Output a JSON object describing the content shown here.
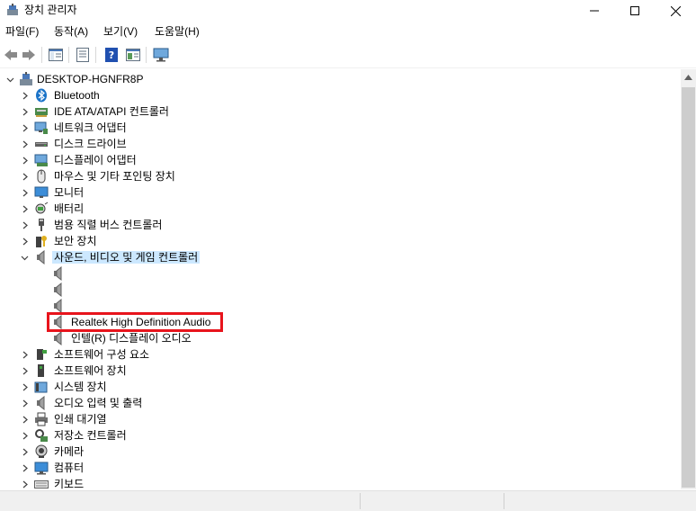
{
  "window": {
    "title": "장치 관리자"
  },
  "menu": [
    "파일(F)",
    "동작(A)",
    "보기(V)",
    "도움말(H)"
  ],
  "icons": {
    "title": "device-manager-icon",
    "back": "back-arrow-icon",
    "forward": "forward-arrow-icon"
  },
  "tree": {
    "root": "DESKTOP-HGNFR8P",
    "categories": [
      {
        "label": "Bluetooth",
        "icon": "bluetooth-icon"
      },
      {
        "label": "IDE ATA/ATAPI 컨트롤러",
        "icon": "ide-controller-icon"
      },
      {
        "label": "네트워크 어댑터",
        "icon": "network-adapter-icon"
      },
      {
        "label": "디스크 드라이브",
        "icon": "disk-drive-icon"
      },
      {
        "label": "디스플레이 어댑터",
        "icon": "display-adapter-icon"
      },
      {
        "label": "마우스 및 기타 포인팅 장치",
        "icon": "mouse-icon"
      },
      {
        "label": "모니터",
        "icon": "monitor-icon"
      },
      {
        "label": "배터리",
        "icon": "battery-icon"
      },
      {
        "label": "범용 직렬 버스 컨트롤러",
        "icon": "usb-icon"
      },
      {
        "label": "보안 장치",
        "icon": "security-device-icon"
      },
      {
        "label": "사운드, 비디오 및 게임 컨트롤러",
        "icon": "speaker-icon",
        "expanded": true
      }
    ],
    "sound_children": [
      {
        "label": "",
        "icon": "speaker-icon"
      },
      {
        "label": "",
        "icon": "speaker-icon"
      },
      {
        "label": "",
        "icon": "speaker-icon"
      },
      {
        "label": "Realtek High Definition Audio",
        "icon": "speaker-icon"
      },
      {
        "label": "인텔(R) 디스플레이 오디오",
        "icon": "speaker-icon"
      }
    ],
    "categories_after": [
      {
        "label": "소프트웨어 구성 요소",
        "icon": "software-component-icon"
      },
      {
        "label": "소프트웨어 장치",
        "icon": "software-device-icon"
      },
      {
        "label": "시스템 장치",
        "icon": "system-device-icon"
      },
      {
        "label": "오디오 입력 및 출력",
        "icon": "audio-io-icon"
      },
      {
        "label": "인쇄 대기열",
        "icon": "printer-icon"
      },
      {
        "label": "저장소 컨트롤러",
        "icon": "storage-controller-icon"
      },
      {
        "label": "카메라",
        "icon": "camera-icon"
      },
      {
        "label": "컴퓨터",
        "icon": "computer-icon"
      },
      {
        "label": "키보드",
        "icon": "keyboard-icon"
      }
    ]
  },
  "colors": {
    "selection": "#cce8ff",
    "highlight_box": "#e8141c"
  }
}
